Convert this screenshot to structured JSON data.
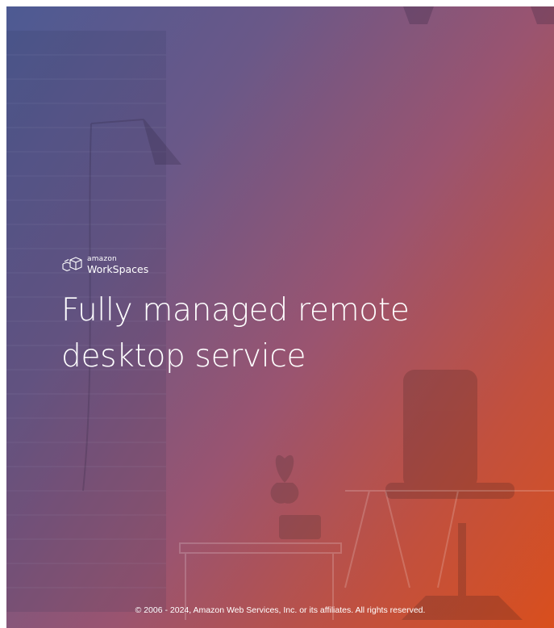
{
  "brand": {
    "logo_icon": "workspaces-cube-icon",
    "company": "amazon",
    "product": "WorkSpaces"
  },
  "hero": {
    "headline_line1": "Fully managed remote",
    "headline_line2": "desktop service",
    "background_colors": [
      "#4d5a93",
      "#9a5470",
      "#d94f1d"
    ]
  },
  "footer": {
    "copyright": "© 2006 - 2024, Amazon Web Services, Inc. or its affiliates. All rights reserved."
  }
}
